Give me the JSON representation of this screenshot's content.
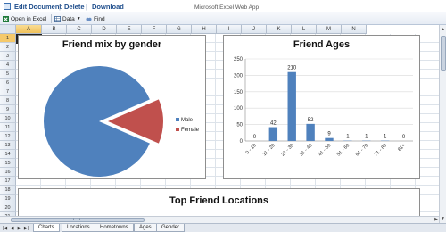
{
  "app": {
    "title": "Microsoft Excel Web App",
    "commands": [
      "Edit Document",
      "Delete",
      "Download"
    ]
  },
  "toolbar": {
    "open_in_excel": "Open in Excel",
    "data": "Data",
    "find": "Find"
  },
  "grid": {
    "columns": [
      "A",
      "B",
      "C",
      "D",
      "E",
      "F",
      "G",
      "H",
      "I",
      "J",
      "K",
      "L",
      "M",
      "N"
    ],
    "selected_column": "A",
    "rows": [
      "1",
      "2",
      "3",
      "4",
      "5",
      "6",
      "7",
      "8",
      "9",
      "10",
      "11",
      "12",
      "13",
      "14",
      "15",
      "16",
      "17",
      "18",
      "19",
      "20",
      "21"
    ],
    "selected_row": "1"
  },
  "charts": {
    "gender": {
      "title": "Friend mix by gender",
      "legend": [
        "Male",
        "Female"
      ]
    },
    "ages": {
      "title": "Friend Ages"
    },
    "locations": {
      "title": "Top Friend Locations"
    }
  },
  "chart_data": [
    {
      "type": "pie",
      "title": "Friend mix by gender",
      "categories": [
        "Male",
        "Female"
      ],
      "values": [
        87,
        13
      ],
      "colors": [
        "#4f81bd",
        "#c0504d"
      ],
      "legend": "right",
      "exploded": "Female"
    },
    {
      "type": "bar",
      "title": "Friend Ages",
      "categories": [
        "0 - 10",
        "11 - 20",
        "21 - 30",
        "31 - 40",
        "41 - 50",
        "51 - 60",
        "61 - 70",
        "71 - 80",
        "81+"
      ],
      "values": [
        0,
        42,
        210,
        52,
        9,
        1,
        1,
        1,
        0
      ],
      "ylim": [
        0,
        250
      ],
      "yticks": [
        "0",
        "50",
        "100",
        "150",
        "200",
        "250"
      ],
      "color": "#4f81bd",
      "grid": true
    }
  ],
  "sheets": [
    "Charts",
    "Locations",
    "Hometowns",
    "Ages",
    "Gender"
  ],
  "active_sheet": "Charts"
}
